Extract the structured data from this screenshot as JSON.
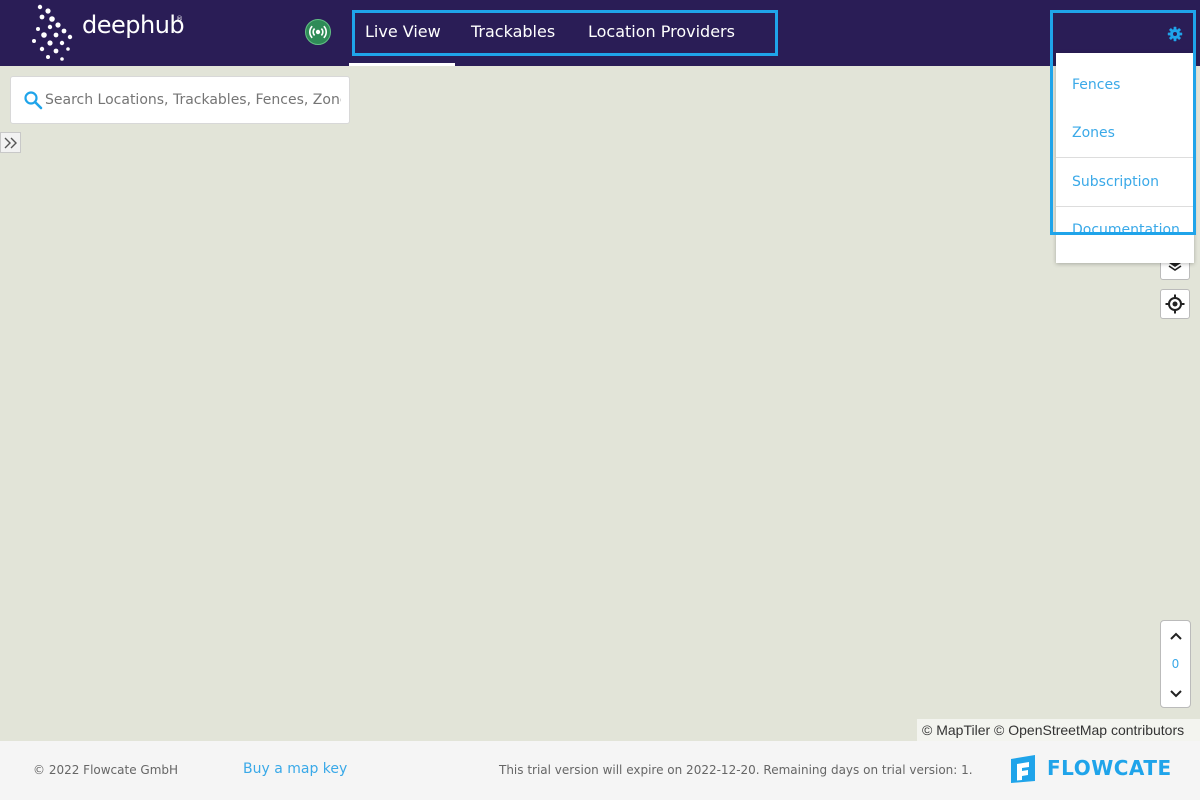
{
  "header": {
    "logo_text": "deephub",
    "logo_mark": "®",
    "nav_tabs": [
      {
        "label": "Live View",
        "active": true
      },
      {
        "label": "Trackables"
      },
      {
        "label": "Location Providers"
      }
    ],
    "settings_menu": [
      "Fences",
      "Zones",
      "Subscription",
      "Documentation"
    ]
  },
  "search": {
    "placeholder": "Search Locations, Trackables, Fences, Zones"
  },
  "map": {
    "floor_level": "0",
    "attribution": "© MapTiler © OpenStreetMap contributors"
  },
  "footer": {
    "copyright": "© 2022 Flowcate GmbH",
    "buy_link": "Buy a map key",
    "trial_notice": "This trial version will expire on 2022-12-20. Remaining days on trial version: 1.",
    "brand": "FLOWCATE"
  },
  "colors": {
    "header_bg": "#2a1d56",
    "accent": "#1fa4ea",
    "status_green": "#2e8b57",
    "map_bg": "#e2e4d8"
  }
}
